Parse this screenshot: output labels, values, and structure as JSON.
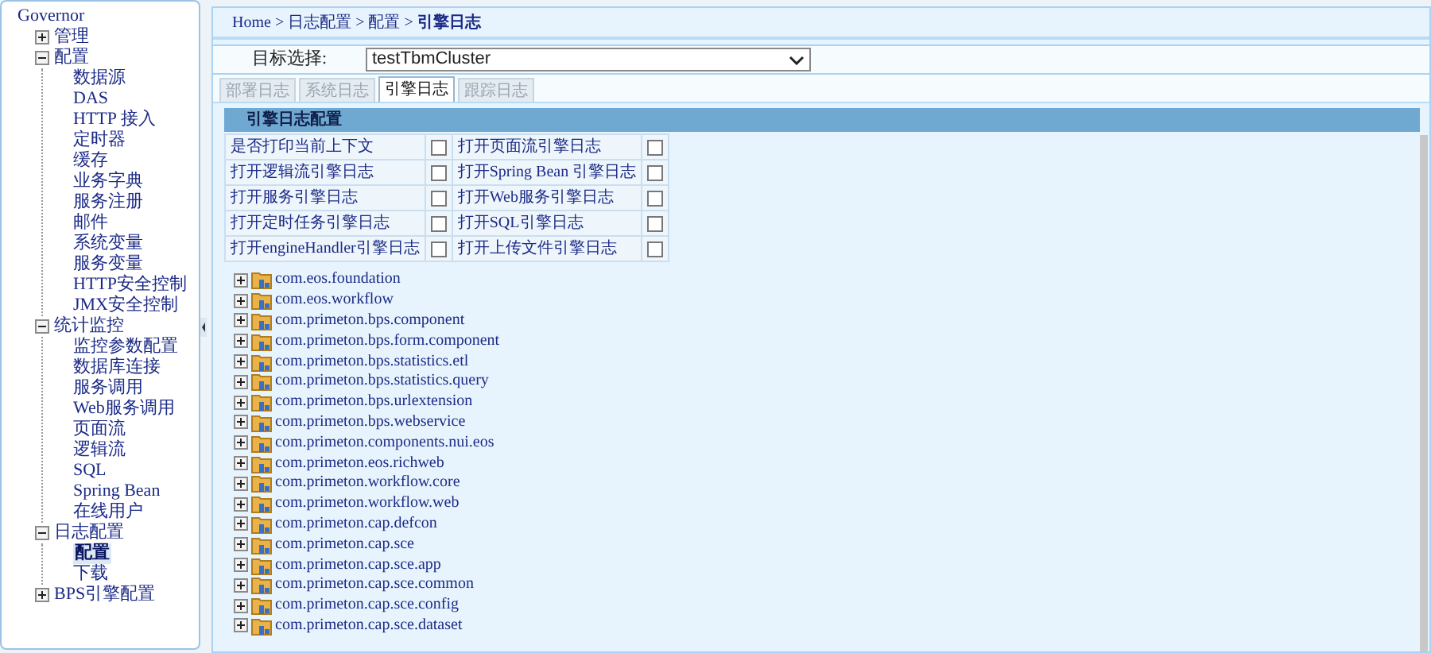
{
  "sidebar": {
    "root": "Governor",
    "items": [
      {
        "label": "管理",
        "expanded": false,
        "selected": false
      },
      {
        "label": "配置",
        "expanded": true,
        "selected": false,
        "children": [
          {
            "label": "数据源",
            "selected": false
          },
          {
            "label": "DAS",
            "selected": false
          },
          {
            "label": "HTTP 接入",
            "selected": false
          },
          {
            "label": "定时器",
            "selected": false
          },
          {
            "label": "缓存",
            "selected": false
          },
          {
            "label": "业务字典",
            "selected": false
          },
          {
            "label": "服务注册",
            "selected": false
          },
          {
            "label": "邮件",
            "selected": false
          },
          {
            "label": "系统变量",
            "selected": false
          },
          {
            "label": "服务变量",
            "selected": false
          },
          {
            "label": "HTTP安全控制",
            "selected": false
          },
          {
            "label": "JMX安全控制",
            "selected": false
          }
        ]
      },
      {
        "label": "统计监控",
        "expanded": true,
        "selected": false,
        "children": [
          {
            "label": "监控参数配置",
            "selected": false
          },
          {
            "label": "数据库连接",
            "selected": false
          },
          {
            "label": "服务调用",
            "selected": false
          },
          {
            "label": "Web服务调用",
            "selected": false
          },
          {
            "label": "页面流",
            "selected": false
          },
          {
            "label": "逻辑流",
            "selected": false
          },
          {
            "label": "SQL",
            "selected": false
          },
          {
            "label": "Spring Bean",
            "selected": false
          },
          {
            "label": "在线用户",
            "selected": false
          }
        ]
      },
      {
        "label": "日志配置",
        "expanded": true,
        "selected": false,
        "children": [
          {
            "label": "配置",
            "selected": true
          },
          {
            "label": "下载",
            "selected": false
          }
        ]
      },
      {
        "label": "BPS引擎配置",
        "expanded": false,
        "selected": false
      }
    ]
  },
  "breadcrumb": "Home > 日志配置 > 配置 > **引擎日志**",
  "target": {
    "label": "目标选择:",
    "value": "testTbmCluster"
  },
  "tabs": [
    {
      "label": "部署日志",
      "selected": false
    },
    {
      "label": "系统日志",
      "selected": false
    },
    {
      "label": "引擎日志",
      "selected": true
    },
    {
      "label": "跟踪日志",
      "selected": false
    }
  ],
  "section_title": "引擎日志配置",
  "options": [
    {
      "label": "是否打印当前上下文",
      "checked": false
    },
    {
      "label": "打开页面流引擎日志",
      "checked": false
    },
    {
      "label": "打开逻辑流引擎日志",
      "checked": false
    },
    {
      "label": "打开Spring Bean 引擎日志",
      "checked": false
    },
    {
      "label": "打开服务引擎日志",
      "checked": false
    },
    {
      "label": "打开Web服务引擎日志",
      "checked": false
    },
    {
      "label": "打开定时任务引擎日志",
      "checked": false
    },
    {
      "label": "打开SQL引擎日志",
      "checked": false
    },
    {
      "label": "打开engineHandler引擎日志",
      "checked": false
    },
    {
      "label": "打开上传文件引擎日志",
      "checked": false
    }
  ],
  "packages": [
    {
      "label": "com.eos.foundation",
      "expanded": false
    },
    {
      "label": "com.eos.workflow",
      "expanded": false
    },
    {
      "label": "com.primeton.bps.component",
      "expanded": false
    },
    {
      "label": "com.primeton.bps.form.component",
      "expanded": false
    },
    {
      "label": "com.primeton.bps.statistics.etl",
      "expanded": false
    },
    {
      "label": "com.primeton.bps.statistics.query",
      "expanded": false
    },
    {
      "label": "com.primeton.bps.urlextension",
      "expanded": false
    },
    {
      "label": "com.primeton.bps.webservice",
      "expanded": false
    },
    {
      "label": "com.primeton.components.nui.eos",
      "expanded": false
    },
    {
      "label": "com.primeton.eos.richweb",
      "expanded": false
    },
    {
      "label": "com.primeton.workflow.core",
      "expanded": false
    },
    {
      "label": "com.primeton.workflow.web",
      "expanded": false
    },
    {
      "label": "com.primeton.cap.defcon",
      "expanded": false
    },
    {
      "label": "com.primeton.cap.sce",
      "expanded": false
    },
    {
      "label": "com.primeton.cap.sce.app",
      "expanded": false
    },
    {
      "label": "com.primeton.cap.sce.common",
      "expanded": false
    },
    {
      "label": "com.primeton.cap.sce.config",
      "expanded": false
    },
    {
      "label": "com.primeton.cap.sce.dataset",
      "expanded": false
    }
  ]
}
